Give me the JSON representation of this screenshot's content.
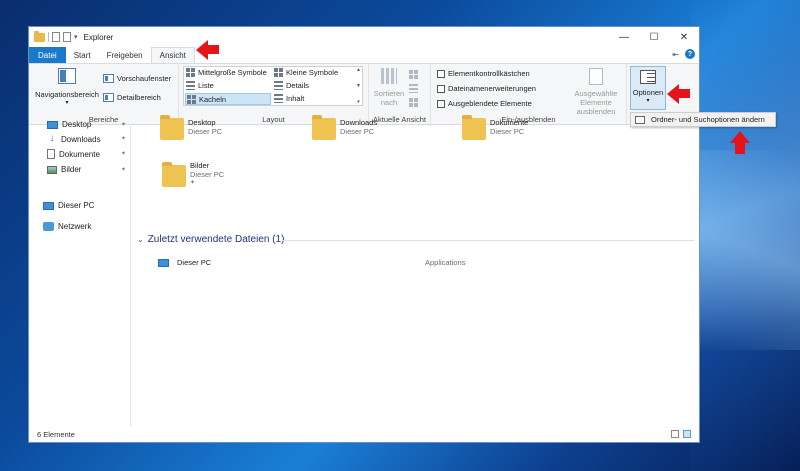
{
  "window": {
    "title": "Explorer",
    "caption": {
      "minimize": "—",
      "maximize": "☐",
      "close": "✕"
    }
  },
  "tabs": [
    {
      "label": "Datei"
    },
    {
      "label": "Start"
    },
    {
      "label": "Freigeben"
    },
    {
      "label": "Ansicht"
    }
  ],
  "ribbon": {
    "panes": {
      "group": "Bereiche",
      "navigation_pane": "Navigationsbereich",
      "preview_pane": "Vorschaufenster",
      "details_pane": "Detailbereich"
    },
    "layout": {
      "group": "Layout",
      "items": [
        "Mittelgroße Symbole",
        "Kleine Symbole",
        "Liste",
        "Details",
        "Kacheln",
        "Inhalt"
      ]
    },
    "current_view": {
      "group": "Aktuelle Ansicht",
      "sort_line1": "Sortieren",
      "sort_line2": "nach"
    },
    "show_hide": {
      "group": "Ein-/ausblenden",
      "checkboxes": [
        "Elementkontrollkästchen",
        "Dateinamenerweiterungen",
        "Ausgeblendete Elemente"
      ],
      "hide_selected_line1": "Ausgewählte",
      "hide_selected_line2": "Elemente ausblenden"
    },
    "options": {
      "label": "Optionen"
    }
  },
  "dropdown": {
    "item": "Ordner- und Suchoptionen ändern"
  },
  "nav": {
    "quick": [
      "Desktop",
      "Downloads",
      "Dokumente",
      "Bilder"
    ],
    "this_pc": "Dieser PC",
    "network": "Netzwerk"
  },
  "content": {
    "tiles": [
      {
        "name": "Desktop",
        "sub": "Dieser PC"
      },
      {
        "name": "Downloads",
        "sub": "Dieser PC"
      },
      {
        "name": "Dokumente",
        "sub": "Dieser PC"
      },
      {
        "name": "Bilder",
        "sub": "Dieser PC"
      }
    ],
    "recent_header": "Zuletzt verwendete Dateien (1)",
    "recent": [
      {
        "name": "Dieser PC",
        "location": "Applications"
      }
    ]
  },
  "status": {
    "count": "6 Elemente"
  },
  "colors": {
    "file_tab": "#1979ca",
    "arrow": "#e5141b",
    "selection": "#cce4f7"
  }
}
